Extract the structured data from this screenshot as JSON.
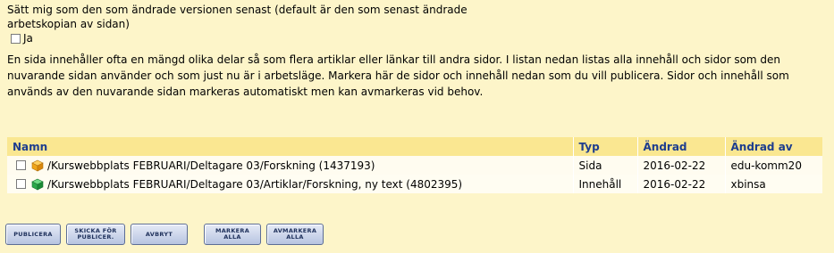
{
  "option": {
    "text": "Sätt mig som den som ändrade versionen senast (default är den som senast ändrade arbetskopian av sidan)",
    "checkbox_label": "Ja"
  },
  "info": {
    "text": "En sida innehåller ofta en mängd olika delar så som flera artiklar eller länkar till andra sidor. I listan nedan listas alla innehåll och sidor som den nuvarande sidan använder och som just nu är i arbetsläge. Markera här de sidor och innehåll nedan som du vill publicera. Sidor och innehåll som används av den nuvarande sidan markeras automatiskt men kan avmarkeras vid behov."
  },
  "table": {
    "headers": {
      "name": "Namn",
      "type": "Typ",
      "changed": "Ändrad",
      "changed_by": "Ändrad av"
    },
    "rows": [
      {
        "name": "/Kurswebbplats FEBRUARI/Deltagare 03/Forskning (1437193)",
        "type": "Sida",
        "changed": "2016-02-22",
        "changed_by": "edu-komm20",
        "icon": "page-cube-icon",
        "icon_color": "#f0a51a"
      },
      {
        "name": "/Kurswebbplats FEBRUARI/Deltagare 03/Artiklar/Forskning, ny text (4802395)",
        "type": "Innehåll",
        "changed": "2016-02-22",
        "changed_by": "xbinsa",
        "icon": "content-cube-icon",
        "icon_color": "#2aa84a"
      }
    ]
  },
  "buttons": {
    "publish": "PUBLICERA",
    "send_for_publish": "SKICKA FÖR\nPUBLICER.",
    "cancel": "AVBRYT",
    "select_all": "MARKERA\nALLA",
    "deselect_all": "AVMARKERA\nALLA"
  },
  "colors": {
    "background": "#fdf5c9",
    "header_bg": "#fae791",
    "header_text": "#1d3d8e",
    "button_bg": "#c4cfe8"
  }
}
